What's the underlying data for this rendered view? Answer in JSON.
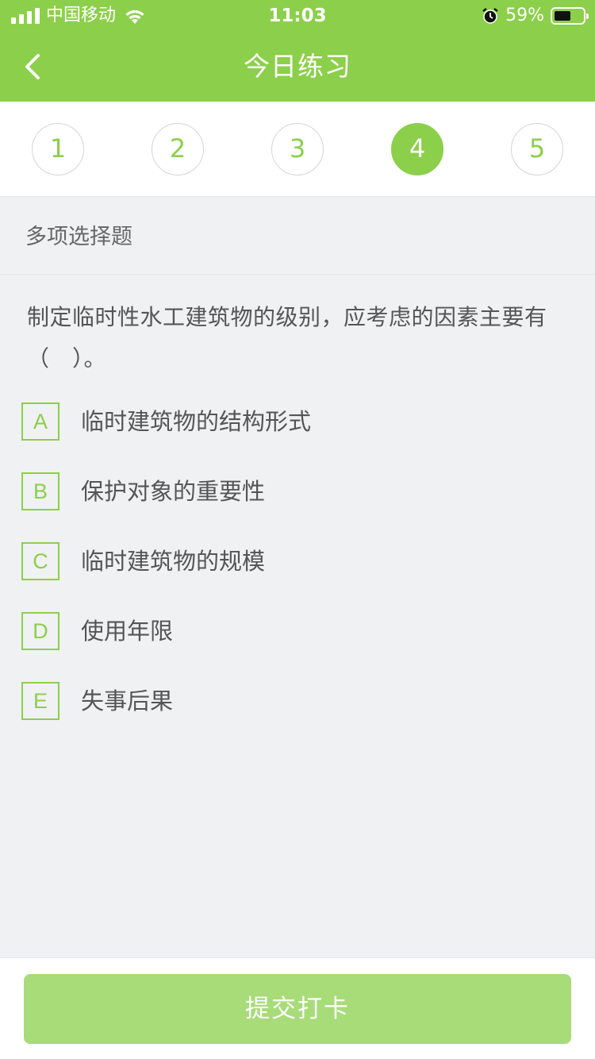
{
  "status_bar": {
    "carrier": "中国移动",
    "time": "11:03",
    "battery_percent": "59%",
    "battery_level": 0.59,
    "icons": [
      "signal-icon",
      "wifi-icon",
      "alarm-icon",
      "battery-icon"
    ]
  },
  "nav": {
    "title": "今日练习",
    "back_icon": "chevron-left-icon"
  },
  "steps": [
    {
      "label": "1",
      "active": false
    },
    {
      "label": "2",
      "active": false
    },
    {
      "label": "3",
      "active": false
    },
    {
      "label": "4",
      "active": true
    },
    {
      "label": "5",
      "active": false
    }
  ],
  "question": {
    "type": "多项选择题",
    "text": "制定临时性水工建筑物的级别，应考虑的因素主要有（　）。",
    "options": [
      {
        "letter": "A",
        "text": "临时建筑物的结构形式"
      },
      {
        "letter": "B",
        "text": "保护对象的重要性"
      },
      {
        "letter": "C",
        "text": "临时建筑物的规模"
      },
      {
        "letter": "D",
        "text": "使用年限"
      },
      {
        "letter": "E",
        "text": "失事后果"
      }
    ]
  },
  "footer": {
    "submit_label": "提交打卡"
  },
  "colors": {
    "accent": "#8ccf4b",
    "submit_disabled": "#a7dc79",
    "background": "#f0f1f3"
  }
}
